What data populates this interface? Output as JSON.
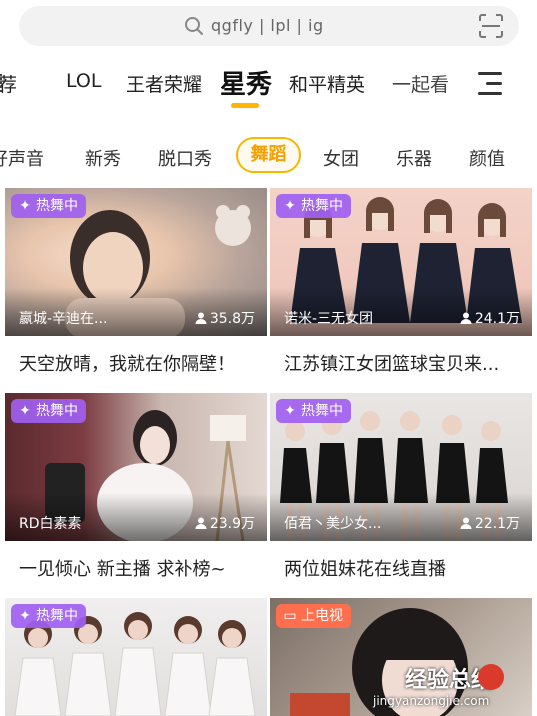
{
  "search": {
    "text": "qgfly | lpl | ig",
    "icon": "search-icon",
    "scan_icon": "scan-icon"
  },
  "category_tabs": [
    {
      "label": "荐",
      "active": false
    },
    {
      "label": "LOL",
      "active": false
    },
    {
      "label": "王者荣耀",
      "active": false
    },
    {
      "label": "星秀",
      "active": true
    },
    {
      "label": "和平精英",
      "active": false
    },
    {
      "label": "一起看",
      "active": false
    }
  ],
  "sub_tabs": [
    {
      "label": "好声音",
      "active": false
    },
    {
      "label": "新秀",
      "active": false
    },
    {
      "label": "脱口秀",
      "active": false
    },
    {
      "label": "舞蹈",
      "active": true
    },
    {
      "label": "女团",
      "active": false
    },
    {
      "label": "乐器",
      "active": false
    },
    {
      "label": "颜值",
      "active": false
    }
  ],
  "colors": {
    "accent": "#ffb400",
    "badge_purple": "#a05ff0",
    "badge_orange": "#ff6f4e"
  },
  "cards": [
    {
      "badge": "热舞中",
      "badge_icon": "sparkle-icon",
      "anchor": "嬴城-辛迪在...",
      "viewers": "35.8万",
      "title": "天空放晴，我就在你隔壁！"
    },
    {
      "badge": "热舞中",
      "badge_icon": "sparkle-icon",
      "anchor": "诺米-三无女团",
      "viewers": "24.1万",
      "title": "江苏镇江女团篮球宝贝来..."
    },
    {
      "badge": "热舞中",
      "badge_icon": "sparkle-icon",
      "anchor": "RD白素素",
      "viewers": "23.9万",
      "title": "一见倾心 新主播 求补榜~"
    },
    {
      "badge": "热舞中",
      "badge_icon": "sparkle-icon",
      "anchor": "佰君丶美少女...",
      "viewers": "22.1万",
      "title": "两位姐妹花在线直播"
    },
    {
      "badge": "热舞中",
      "badge_icon": "sparkle-icon",
      "anchor": "",
      "viewers": "",
      "title": ""
    },
    {
      "badge": "上电视",
      "badge_icon": "tv-icon",
      "anchor": "",
      "viewers": "",
      "title": ""
    }
  ],
  "watermark": {
    "cn": "经验总结",
    "en": "jingyanzongjie.com"
  }
}
